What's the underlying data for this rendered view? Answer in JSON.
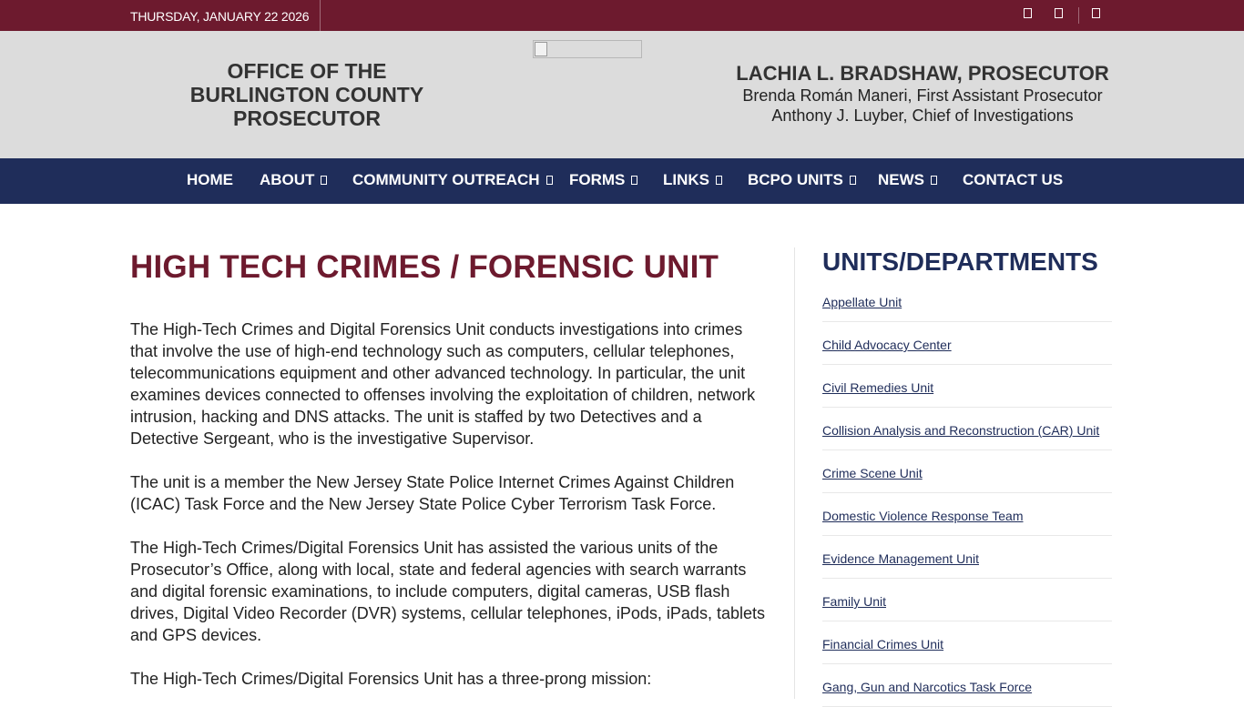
{
  "topbar": {
    "date": "THURSDAY, JANUARY 22 2026",
    "social_icons": [
      "facebook-icon",
      "twitter-icon",
      "instagram-icon"
    ]
  },
  "header": {
    "office_title": "OFFICE OF THE BURLINGTON COUNTY PROSECUTOR",
    "prosecutor_name": "LACHIA L. BRADSHAW, PROSECUTOR",
    "first_assistant": "Brenda Román Maneri, First Assistant Prosecutor",
    "chief": "Anthony J. Luyber, Chief of Investigations"
  },
  "nav": {
    "items": [
      {
        "label": "HOME"
      },
      {
        "label": "ABOUT"
      },
      {
        "label": "COMMUNITY OUTREACH"
      },
      {
        "label": "FORMS"
      },
      {
        "label": "LINKS"
      },
      {
        "label": "BCPO UNITS"
      },
      {
        "label": "NEWS"
      },
      {
        "label": "CONTACT US"
      }
    ]
  },
  "main": {
    "title": "HIGH TECH CRIMES / FORENSIC UNIT",
    "paragraphs": [
      "The High-Tech Crimes and Digital Forensics Unit conducts investigations into crimes that involve the use of high-end technology such as computers, cellular telephones, telecommunications equipment and other advanced technology. In particular, the unit examines devices connected to offenses involving the exploitation of children, network intrusion, hacking and DNS attacks. The unit is staffed by two Detectives and a Detective Sergeant, who is the investigative Supervisor.",
      "The unit is a member the New Jersey State Police Internet Crimes Against Children (ICAC) Task Force and the New Jersey State Police Cyber Terrorism Task Force.",
      "The High-Tech Crimes/Digital Forensics Unit has assisted the various units of the Prosecutor’s Office, along with local, state and federal agencies with search warrants and digital forensic examinations, to include computers, digital cameras, USB flash drives, Digital Video Recorder (DVR) systems, cellular telephones, iPods, iPads, tablets and GPS devices.",
      "The High-Tech Crimes/Digital Forensics Unit has a three-prong mission:"
    ]
  },
  "sidebar": {
    "title": "UNITS/DEPARTMENTS",
    "links": [
      {
        "label": "Appellate Unit"
      },
      {
        "label": "Child Advocacy Center"
      },
      {
        "label": "Civil Remedies Unit"
      },
      {
        "label": "Collision Analysis and Reconstruction (CAR) Unit"
      },
      {
        "label": "Crime Scene Unit"
      },
      {
        "label": "Domestic Violence Response Team"
      },
      {
        "label": "Evidence Management Unit"
      },
      {
        "label": "Family Unit"
      },
      {
        "label": "Financial Crimes Unit"
      },
      {
        "label": "Gang, Gun and Narcotics Task Force"
      }
    ]
  },
  "colors": {
    "topbar": "#6d1a2e",
    "header_bg": "#dcdcdc",
    "nav_bg": "#1f2d5a",
    "title_maroon": "#6d1a2e",
    "sidebar_navy": "#1f2d5a"
  }
}
